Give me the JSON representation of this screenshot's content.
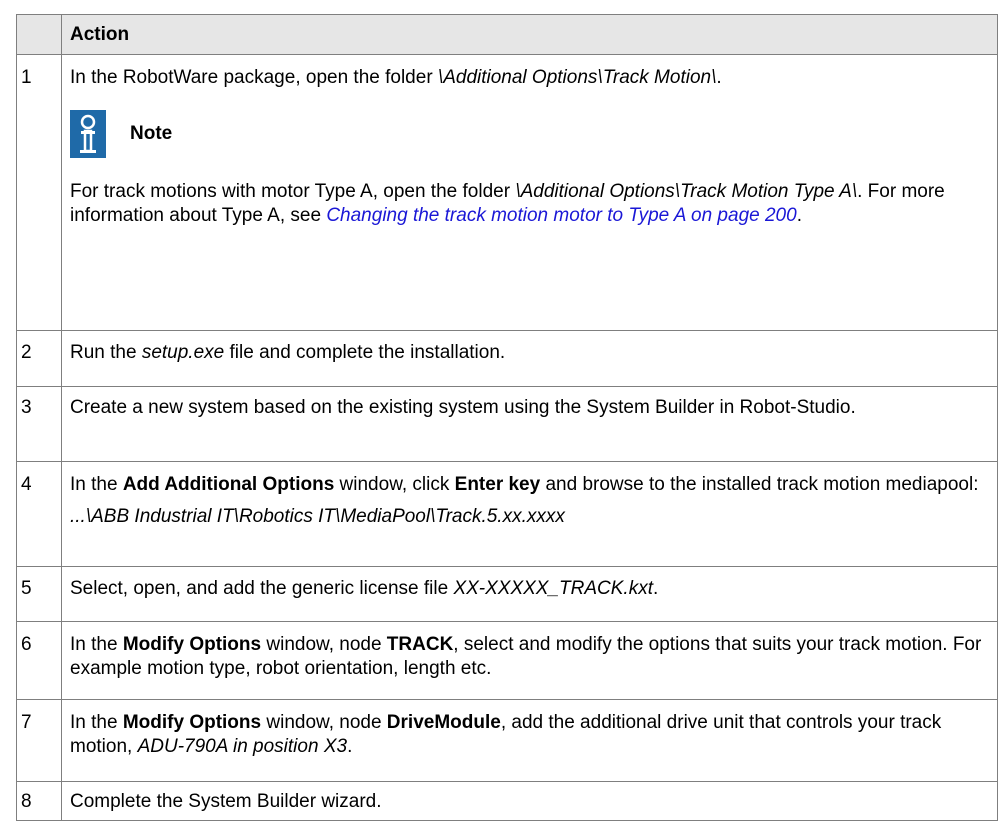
{
  "header": {
    "num": "",
    "action": "Action"
  },
  "steps": [
    {
      "num": "1",
      "pre": "In the RobotWare package, open the folder ",
      "path": "\\Additional Options\\Track Motion\\",
      "post": ".",
      "note": {
        "title": "Note",
        "icon": "info-icon",
        "pre": "For track motions with motor Type A, open the folder ",
        "path": "\\Additional Options\\Track Motion Type A\\",
        "mid": ". For more information about Type A, see ",
        "link": "Changing the track motion motor to Type A on page 200",
        "post": "."
      }
    },
    {
      "num": "2",
      "pre": "Run the ",
      "file": "setup.exe",
      "post": " file and complete the installation."
    },
    {
      "num": "3",
      "text": "Create a new system based on the existing system using the System Builder in Robot-Studio."
    },
    {
      "num": "4",
      "t1": "In the ",
      "b1": "Add Additional Options",
      "t2": " window, click ",
      "b2": "Enter key",
      "t3": " and browse to the installed track motion mediapool:",
      "path": "...\\ABB Industrial IT\\Robotics IT\\MediaPool\\Track.5.xx.xxxx"
    },
    {
      "num": "5",
      "pre": "Select, open, and add the generic license file ",
      "file": "XX-XXXXX_TRACK.kxt",
      "post": "."
    },
    {
      "num": "6",
      "t1": "In the ",
      "b1": "Modify Options",
      "t2": " window, node ",
      "b2": "TRACK",
      "t3": ", select and modify the options that suits your track motion. For example motion type, robot orientation, length etc."
    },
    {
      "num": "7",
      "t1": "In the ",
      "b1": "Modify Options",
      "t2": " window, node ",
      "b2": "DriveModule",
      "t3": ", add the additional drive unit that controls your track motion, ",
      "i1": "ADU-790A in position X3",
      "t4": "."
    },
    {
      "num": "8",
      "text": "Complete the System Builder wizard."
    }
  ],
  "colors": {
    "link": "#1a17d6",
    "icon": "#1f6aa8",
    "header_bg": "#e6e6e6",
    "border": "#7f7f7f"
  }
}
